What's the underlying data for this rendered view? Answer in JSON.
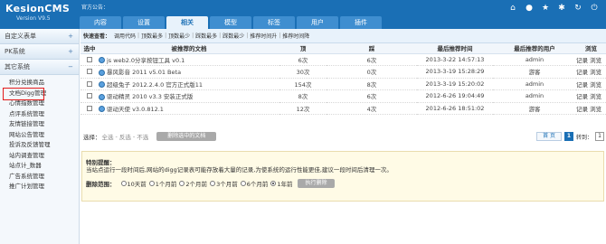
{
  "app": {
    "logo": "KesionCMS",
    "version": "Version V9.5",
    "announcement": "官方公告："
  },
  "tabs": [
    "内容",
    "设置",
    "相关",
    "模型",
    "标签",
    "用户",
    "插件"
  ],
  "top_icons": [
    "home-icon",
    "user-icon",
    "star-icon",
    "gear-icon",
    "refresh-icon",
    "exit-icon"
  ],
  "sidebar": {
    "sections": [
      {
        "label": "自定义表单"
      },
      {
        "label": "PK系统"
      },
      {
        "label": "其它系统"
      }
    ],
    "items": [
      "积分兑换商品",
      "文档Digg管理",
      "心情指数管理",
      "点评系统管理",
      "友情链接管理",
      "网站公告管理",
      "投诉及反馈管理",
      "站内调查管理",
      "站点计_数器",
      "广告系统管理",
      "推广计划管理"
    ]
  },
  "quick_bar": {
    "lead": "快速查看：",
    "links": [
      "调用代码",
      "顶数最多",
      "顶数最少",
      "踩数最多",
      "踩数最少",
      "推荐时间升",
      "推荐时间降"
    ]
  },
  "table": {
    "columns": [
      "选中",
      "被推荐的文档",
      "顶",
      "踩",
      "最后推荐时间",
      "最后推荐的用户",
      "浏览"
    ],
    "rows": [
      {
        "title": "js web2.0分享按钮工具 v0.1",
        "up": "6次",
        "down": "6次",
        "time": "2013-3-22 14:57:13",
        "user": "admin",
        "ops": "记录 浏览"
      },
      {
        "title": "暴风影音 2011 v5.01 Beta",
        "up": "30次",
        "down": "0次",
        "time": "2013-3-19 15:28:29",
        "user": "游客",
        "ops": "记录 浏览"
      },
      {
        "title": "超级兔子 2012.2.4.0 官方正式版11",
        "up": "154次",
        "down": "8次",
        "time": "2013-3-19 15:20:02",
        "user": "admin",
        "ops": "记录 浏览"
      },
      {
        "title": "驱动精灵 2010 v3.3 安装正式版",
        "up": "8次",
        "down": "6次",
        "time": "2012-6-26 19:04:49",
        "user": "admin",
        "ops": "记录 浏览"
      },
      {
        "title": "驱动天使 v3.0.812.1",
        "up": "12次",
        "down": "4次",
        "time": "2012-6-26 18:51:02",
        "user": "游客",
        "ops": "记录 浏览"
      }
    ]
  },
  "select_bar": {
    "label": "选择：",
    "all": "全选",
    "invert": "反选",
    "none": "不选",
    "delete_button": "删除选中的文档"
  },
  "pager": {
    "first": "首 页",
    "current": "1",
    "jump_label": "转到：",
    "page_value": "1"
  },
  "notice": {
    "title": "特别提醒：",
    "text": "当站点运行一段时间后,网站的digg记录表可能存放着大量的记录,为使系统的运行性能更佳,建议一段时间后清理一次。",
    "range_label": "删除范围：",
    "options": [
      "10天前",
      "1个月前",
      "2个月前",
      "3个月前",
      "6个月前",
      "1年前"
    ],
    "selected_index": 5,
    "execute_button": "执行删除"
  }
}
